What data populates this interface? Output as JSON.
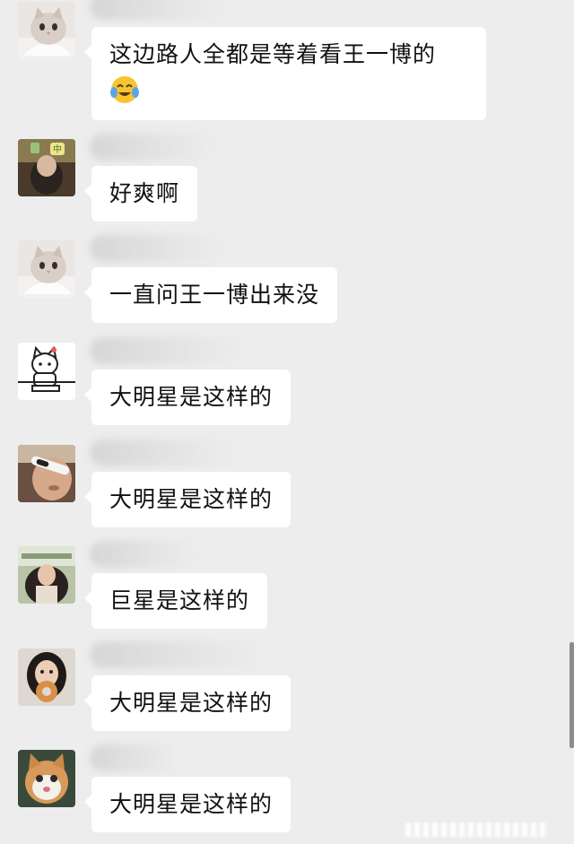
{
  "messages": [
    {
      "text": "这边路人全都是等着看王一博的",
      "emoji": "crying-laughing-face"
    },
    {
      "text": "好爽啊"
    },
    {
      "text": "一直问王一博出来没"
    },
    {
      "text": "大明星是这样的"
    },
    {
      "text": "大明星是这样的"
    },
    {
      "text": "巨星是这样的"
    },
    {
      "text": "大明星是这样的"
    },
    {
      "text": "大明星是这样的"
    }
  ],
  "colors": {
    "background": "#ededed",
    "bubble": "#ffffff",
    "text": "#111111"
  }
}
